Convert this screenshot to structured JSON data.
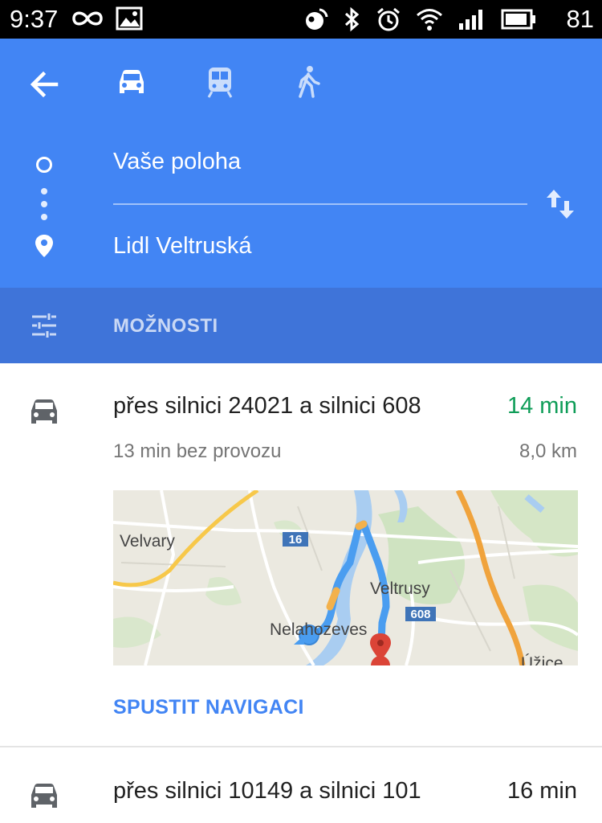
{
  "status_bar": {
    "time": "9:37",
    "battery": "81",
    "icons": [
      "infinity-icon",
      "image-icon",
      "location-icon",
      "bluetooth-icon",
      "alarm-icon",
      "wifi-icon",
      "signal-icon",
      "battery-icon"
    ]
  },
  "colors": {
    "header_blue": "#4285f4",
    "options_blue": "#3f74d9",
    "traffic_green": "#0f9d58",
    "route_blue": "#4a9df0",
    "link_blue": "#4285f4"
  },
  "header": {
    "origin": "Vaše poloha",
    "destination": "Lidl Veltruská",
    "modes": [
      "car-icon",
      "train-icon",
      "walk-icon"
    ],
    "selected_mode": "car"
  },
  "options": {
    "label": "MOŽNOSTI"
  },
  "routes": [
    {
      "title": "přes silnici 24021 a silnici 608",
      "time": "14 min",
      "subtitle": "13 min bez provozu",
      "distance": "8,0 km",
      "map_labels": {
        "velvary": "Velvary",
        "veltrusy": "Veltrusy",
        "nelahozeves": "Nelahozeves",
        "uzice": "Úžice",
        "road_16": "16",
        "road_608": "608"
      },
      "action": "SPUSTIT NAVIGACI"
    },
    {
      "title": "přes silnici 10149 a silnici 101",
      "time": "16 min"
    }
  ]
}
